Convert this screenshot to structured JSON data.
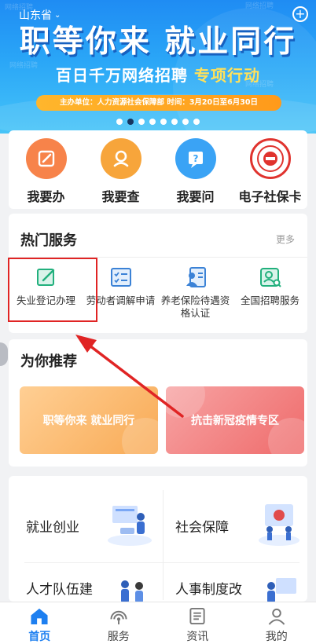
{
  "banner": {
    "region": "山东省",
    "slogan": "职等你来 就业同行",
    "campaign_prefix": "百日千万网络招聘",
    "campaign_highlight": "专项行动",
    "organizer": "主办单位：人力资源社会保障部 时间：3月20日至6月30日",
    "watermark": "网络招聘",
    "slide_count": 8,
    "active_slide": 1
  },
  "quick_actions": [
    {
      "label": "我要办",
      "icon": "pen-icon",
      "color": "#f7834a"
    },
    {
      "label": "我要查",
      "icon": "search-person-icon",
      "color": "#f7a53b"
    },
    {
      "label": "我要问",
      "icon": "question-icon",
      "color": "#3aa3f5"
    },
    {
      "label": "电子社保卡",
      "icon": "social-security-seal-icon",
      "color": "#e0332e"
    }
  ],
  "hot_services": {
    "title": "热门服务",
    "more": "更多",
    "items": [
      {
        "label": "失业登记办理",
        "icon": "edit-form-icon"
      },
      {
        "label": "劳动者调解申请",
        "icon": "checklist-icon"
      },
      {
        "label": "养老保险待遇资格认证",
        "icon": "id-card-person-icon"
      },
      {
        "label": "全国招聘服务",
        "icon": "person-search-icon"
      }
    ]
  },
  "recommend": {
    "title": "为你推荐",
    "cards": [
      {
        "label": "职等你来 就业同行",
        "color": "#f8aa55"
      },
      {
        "label": "抗击新冠疫情专区",
        "color": "#ef6b6b"
      }
    ]
  },
  "categories": [
    {
      "label": "就业创业",
      "icon": "business-meeting-icon"
    },
    {
      "label": "社会保障",
      "icon": "security-shield-icon"
    },
    {
      "label": "人才队伍建",
      "icon": "team-icon"
    },
    {
      "label": "人事制度改",
      "icon": "reform-icon"
    }
  ],
  "tabbar": [
    {
      "label": "首页",
      "icon": "home-icon",
      "active": true
    },
    {
      "label": "服务",
      "icon": "signal-icon",
      "active": false
    },
    {
      "label": "资讯",
      "icon": "news-icon",
      "active": false
    },
    {
      "label": "我的",
      "icon": "user-icon",
      "active": false
    }
  ],
  "colors": {
    "accent": "#1d7ff0",
    "highlight_box": "#e02424",
    "arrow": "#e02424"
  }
}
